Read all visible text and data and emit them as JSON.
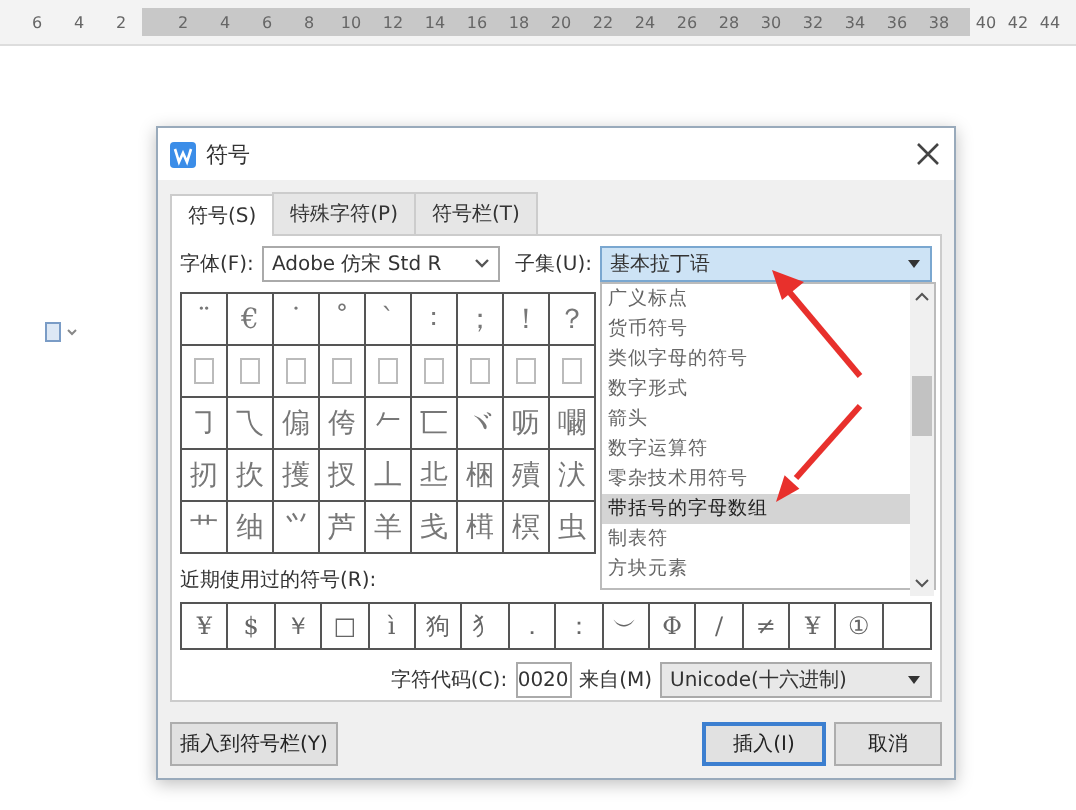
{
  "ruler": {
    "left_numbers": [
      "6",
      "4",
      "2"
    ],
    "text_numbers": [
      "2",
      "4",
      "6",
      "8",
      "10",
      "12",
      "14",
      "16",
      "18",
      "20",
      "22",
      "24",
      "26",
      "28",
      "30",
      "32",
      "34",
      "36",
      "38"
    ],
    "right_numbers": [
      "40",
      "42",
      "44"
    ]
  },
  "dialog": {
    "title": "符号",
    "tabs": [
      {
        "label": "符号(S)",
        "selected": true
      },
      {
        "label": "特殊字符(P)",
        "selected": false
      },
      {
        "label": "符号栏(T)",
        "selected": false
      }
    ],
    "font_label": "字体(F):",
    "font_value": "Adobe 仿宋 Std R",
    "subset_label": "子集(U):",
    "subset_value": "基本拉丁语",
    "symbol_grid": [
      [
        {
          "kind": "char",
          "text": "¨"
        },
        {
          "kind": "char",
          "text": "€"
        },
        {
          "kind": "char",
          "text": "˙"
        },
        {
          "kind": "char",
          "text": "˚"
        },
        {
          "kind": "char",
          "text": "ˋ"
        },
        {
          "kind": "char",
          "text": "∶"
        },
        {
          "kind": "char",
          "text": "；"
        },
        {
          "kind": "char",
          "text": "！"
        },
        {
          "kind": "char",
          "text": "？"
        }
      ],
      [
        {
          "kind": "missing"
        },
        {
          "kind": "missing"
        },
        {
          "kind": "missing"
        },
        {
          "kind": "missing"
        },
        {
          "kind": "missing"
        },
        {
          "kind": "missing"
        },
        {
          "kind": "missing"
        },
        {
          "kind": "missing"
        },
        {
          "kind": "missing"
        }
      ],
      [
        {
          "kind": "char",
          "text": "㇆"
        },
        {
          "kind": "char",
          "text": "乁"
        },
        {
          "kind": "char",
          "text": "傓"
        },
        {
          "kind": "char",
          "text": "侉"
        },
        {
          "kind": "char",
          "text": "𠂉"
        },
        {
          "kind": "char",
          "text": "匸"
        },
        {
          "kind": "char",
          "text": "ヾ"
        },
        {
          "kind": "char",
          "text": "呖"
        },
        {
          "kind": "char",
          "text": "㘚"
        }
      ],
      [
        {
          "kind": "char",
          "text": "扨"
        },
        {
          "kind": "char",
          "text": "扻"
        },
        {
          "kind": "char",
          "text": "擭"
        },
        {
          "kind": "char",
          "text": "扠"
        },
        {
          "kind": "char",
          "text": "丄"
        },
        {
          "kind": "char",
          "text": "丠"
        },
        {
          "kind": "char",
          "text": "梱"
        },
        {
          "kind": "char",
          "text": "殰"
        },
        {
          "kind": "char",
          "text": "汱"
        }
      ],
      [
        {
          "kind": "char",
          "text": "艹"
        },
        {
          "kind": "char",
          "text": "䌷"
        },
        {
          "kind": "char",
          "text": "⺍"
        },
        {
          "kind": "char",
          "text": "芦"
        },
        {
          "kind": "char",
          "text": "羊"
        },
        {
          "kind": "char",
          "text": "戋"
        },
        {
          "kind": "char",
          "text": "榵"
        },
        {
          "kind": "char",
          "text": "榠"
        },
        {
          "kind": "char",
          "text": "虫"
        }
      ]
    ],
    "subset_list": [
      {
        "label": "广义标点",
        "selected": false
      },
      {
        "label": "货币符号",
        "selected": false
      },
      {
        "label": "类似字母的符号",
        "selected": false
      },
      {
        "label": "数字形式",
        "selected": false
      },
      {
        "label": "箭头",
        "selected": false
      },
      {
        "label": "数字运算符",
        "selected": false
      },
      {
        "label": "零杂技术用符号",
        "selected": false
      },
      {
        "label": "带括号的字母数组",
        "selected": true
      },
      {
        "label": "制表符",
        "selected": false
      },
      {
        "label": "方块元素",
        "selected": false
      }
    ],
    "recent_label": "近期使用过的符号(R):",
    "recent": [
      "¥",
      "$",
      "￥",
      "□",
      "ì",
      "狗",
      "犭",
      "．",
      "：",
      "︶",
      "Φ",
      "/",
      "≠",
      "¥",
      "①"
    ],
    "code_label": "字符代码(C):",
    "code_value": "0020",
    "from_label": "来自(M)",
    "from_value": "Unicode(十六进制)",
    "buttons": [
      {
        "label": "插入到符号栏(Y)",
        "kind": "secondary"
      },
      {
        "label": "插入(I)",
        "kind": "default"
      },
      {
        "label": "取消",
        "kind": "normal"
      }
    ]
  }
}
